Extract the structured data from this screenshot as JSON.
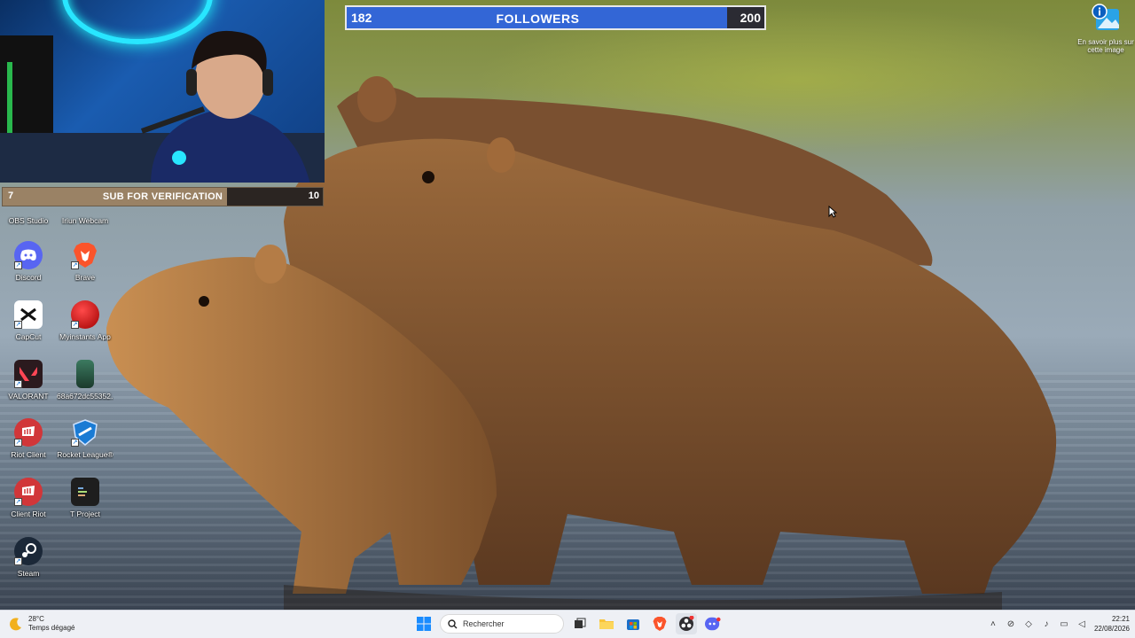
{
  "followers_bar": {
    "current": "182",
    "title": "FOLLOWERS",
    "goal": "200",
    "progress": 0.91,
    "fill_color": "#3366d6"
  },
  "sub_bar": {
    "current": "7",
    "title": "SUB FOR VERIFICATION",
    "goal": "10",
    "progress": 0.7
  },
  "learn_more": {
    "icon": "info-picture-icon",
    "label_line1": "En savoir plus sur",
    "label_line2": "cette image"
  },
  "desktop_icons": [
    {
      "label": "OBS Studio",
      "icon": "obs-icon"
    },
    {
      "label": "Iriun Webcam",
      "icon": "webcam-icon"
    },
    {
      "label": "Discord",
      "icon": "discord-icon",
      "color": "#5865f2"
    },
    {
      "label": "Brave",
      "icon": "brave-icon",
      "color": "#fb542b"
    },
    {
      "label": "CapCut",
      "icon": "capcut-icon",
      "color": "#111111"
    },
    {
      "label": "Myinstants App",
      "icon": "myinstants-icon",
      "color": "#c8102e"
    },
    {
      "label": "VALORANT",
      "icon": "valorant-icon",
      "color": "#ff4655"
    },
    {
      "label": "68a672dc55352...",
      "icon": "image-file-icon"
    },
    {
      "label": "Riot Client",
      "icon": "riot-client-icon",
      "color": "#d13639"
    },
    {
      "label": "Rocket League®",
      "icon": "rocket-league-icon",
      "color": "#1a7bd4"
    },
    {
      "label": "Client Riot",
      "icon": "riot-client-icon",
      "color": "#d13639"
    },
    {
      "label": "T Project",
      "icon": "project-icon"
    },
    {
      "label": "Steam",
      "icon": "steam-icon",
      "color": "#1b2838"
    }
  ],
  "taskbar": {
    "weather_temp": "28°C",
    "weather_desc": "Temps dégagé",
    "search_placeholder": "Rechercher",
    "time": "22:21",
    "date": "22/08/2026",
    "apps": [
      "windows-start-icon",
      "task-view-icon",
      "file-explorer-icon",
      "microsoft-store-icon",
      "brave-icon",
      "obs-icon",
      "discord-icon"
    ]
  }
}
